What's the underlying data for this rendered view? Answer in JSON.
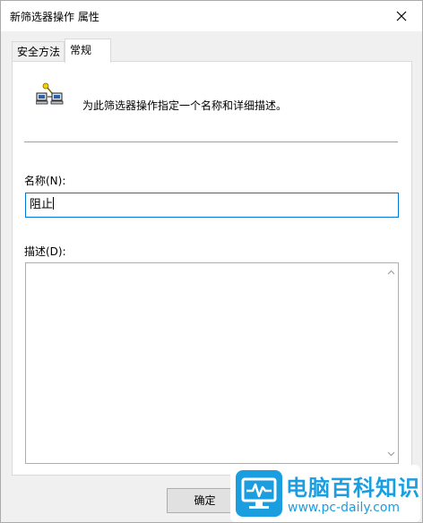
{
  "window": {
    "title": "新筛选器操作 属性"
  },
  "tabs": [
    {
      "label": "安全方法",
      "active": false
    },
    {
      "label": "常规",
      "active": true
    }
  ],
  "general": {
    "description_hint": "为此筛选器操作指定一个名称和详细描述。",
    "name_label": "名称(N):",
    "name_value": "阻止",
    "description_label": "描述(D):",
    "description_value": ""
  },
  "buttons": {
    "ok": "确定"
  },
  "watermark": {
    "title": "电脑百科知识",
    "url": "www.pc-daily.com"
  },
  "colors": {
    "focus_border": "#0078d7",
    "watermark_blue": "#1a9ee0",
    "panel_bg": "#ffffff",
    "window_bg": "#f0f0f0"
  },
  "icons": {
    "close": "close-icon",
    "filter_action": "network-filter-icon",
    "scroll_up": "chevron-up-icon",
    "scroll_down": "chevron-down-icon",
    "watermark_logo": "monitor-pulse-icon"
  }
}
